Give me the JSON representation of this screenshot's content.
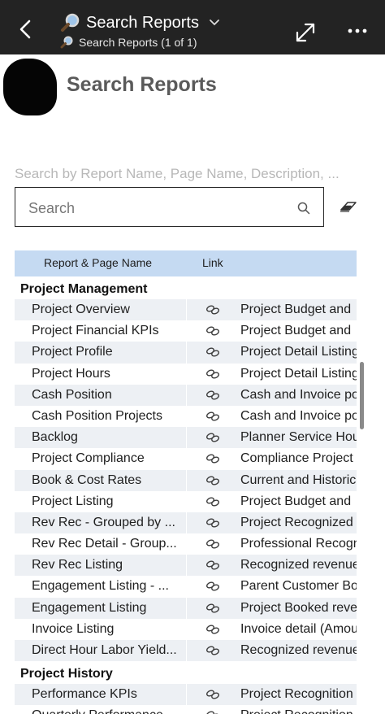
{
  "topbar": {
    "title": "Search Reports",
    "subtitle": "Search Reports (1 of 1)"
  },
  "report": {
    "title": "Search Reports",
    "search_description": "Search by Report Name, Page Name, Description, ...",
    "search_placeholder": "Search"
  },
  "table": {
    "headers": [
      "Report & Page Name",
      "Link"
    ],
    "groups": [
      {
        "name": "Project Management",
        "rows": [
          {
            "name": "Project Overview",
            "desc": "Project Budget and"
          },
          {
            "name": "Project Financial KPIs",
            "desc": "Project Budget and"
          },
          {
            "name": "Project Profile",
            "desc": "Project Detail Listing"
          },
          {
            "name": "Project Hours",
            "desc": "Project Detail Listing"
          },
          {
            "name": "Cash Position",
            "desc": "Cash and Invoice po"
          },
          {
            "name": "Cash Position Projects",
            "desc": "Cash and Invoice po"
          },
          {
            "name": "Backlog",
            "desc": "Planner Service Hou"
          },
          {
            "name": "Project Compliance",
            "desc": "Compliance Project"
          },
          {
            "name": "Book & Cost Rates",
            "desc": "Current and Historic"
          },
          {
            "name": "Project Listing",
            "desc": "Project Budget and"
          },
          {
            "name": "Rev Rec - Grouped by ...",
            "desc": "Project Recognized"
          },
          {
            "name": "Rev Rec Detail - Group...",
            "desc": "Professional Recogn"
          },
          {
            "name": "Rev Rec Listing",
            "desc": "Recognized revenue"
          },
          {
            "name": "Engagement Listing - ...",
            "desc": "Parent Customer Bo"
          },
          {
            "name": "Engagement Listing",
            "desc": "Project Booked reve"
          },
          {
            "name": "Invoice Listing",
            "desc": "Invoice detail (Amou"
          },
          {
            "name": "Direct Hour Labor Yield...",
            "desc": "Recognized revenue"
          }
        ]
      },
      {
        "name": "Project History",
        "rows": [
          {
            "name": "Performance KPIs",
            "desc": "Project Recognition"
          },
          {
            "name": "Quarterly Performance",
            "desc": "Project Recognition"
          }
        ]
      }
    ]
  }
}
